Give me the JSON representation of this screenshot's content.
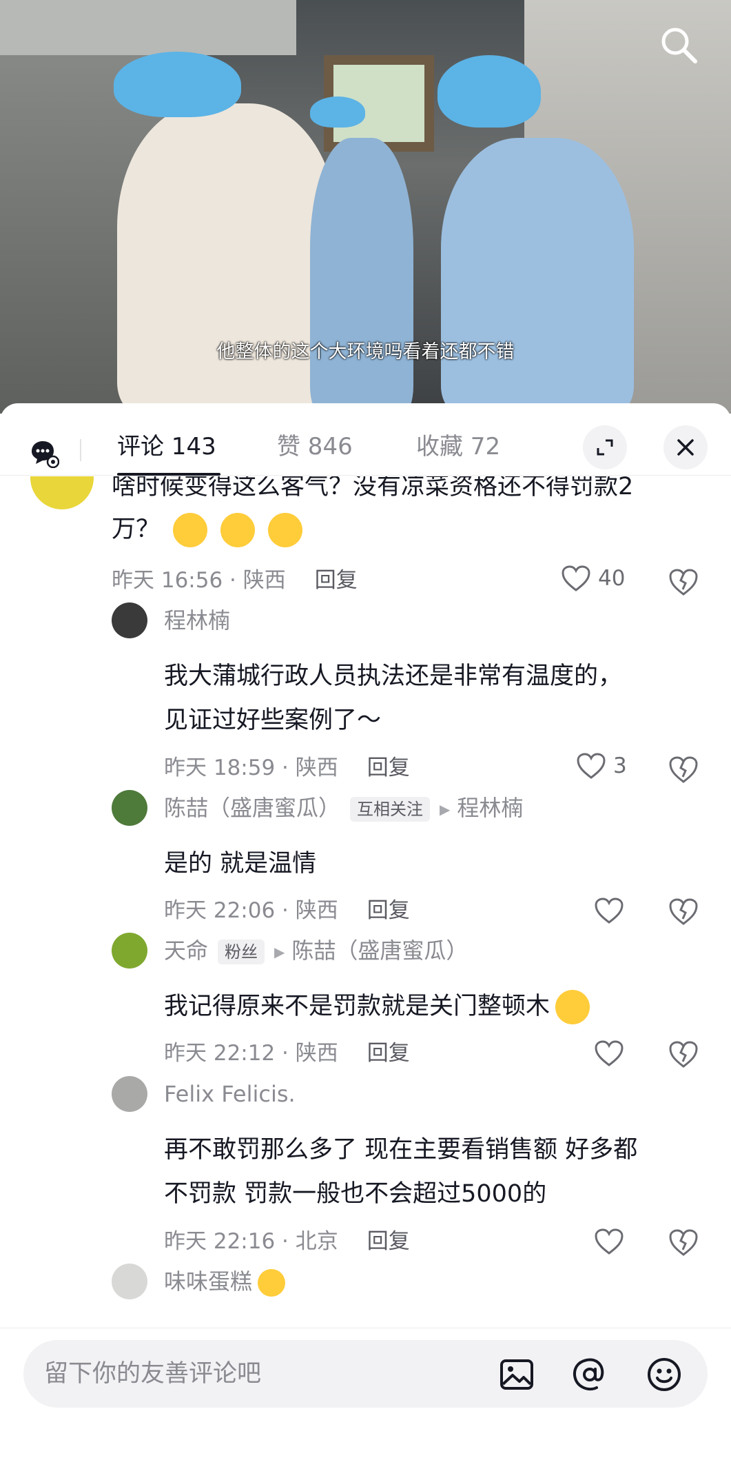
{
  "video": {
    "subtitle": "他整体的这个大环境吗看着还都不错"
  },
  "tabs": {
    "comments": "评论 143",
    "likes": "赞 846",
    "favorites": "收藏 72"
  },
  "comments": [
    {
      "text_line1": "啥时候变得这么客气？没有凉菜资格还不得罚款2",
      "text_line2": "万？",
      "time": "昨天 16:56 · 陕西",
      "reply": "回复",
      "likes": "40"
    }
  ],
  "replies": [
    {
      "user": "程林楠",
      "text_line1": "我大蒲城行政人员执法还是非常有温度的，",
      "text_line2": "见证过好些案例了～",
      "time": "昨天 18:59 · 陕西",
      "reply": "回复",
      "likes": "3"
    },
    {
      "user": "陈喆（盛唐蜜瓜）",
      "badge": "互相关注",
      "target": "程林楠",
      "text_line1": "是的 就是温情",
      "time": "昨天 22:06 · 陕西",
      "reply": "回复"
    },
    {
      "user": "天命",
      "badge": "粉丝",
      "target": "陈喆（盛唐蜜瓜）",
      "text_line1": "我记得原来不是罚款就是关门整顿木",
      "time": "昨天 22:12 · 陕西",
      "reply": "回复"
    },
    {
      "user": "Felix Felicis.",
      "text_line1": "再不敢罚那么多了 现在主要看销售额 好多都",
      "text_line2": "不罚款 罚款一般也不会超过5000的",
      "time": "昨天 22:16 · 北京",
      "reply": "回复"
    },
    {
      "user": "味味蛋糕"
    }
  ],
  "input": {
    "placeholder": "留下你的友善评论吧"
  }
}
